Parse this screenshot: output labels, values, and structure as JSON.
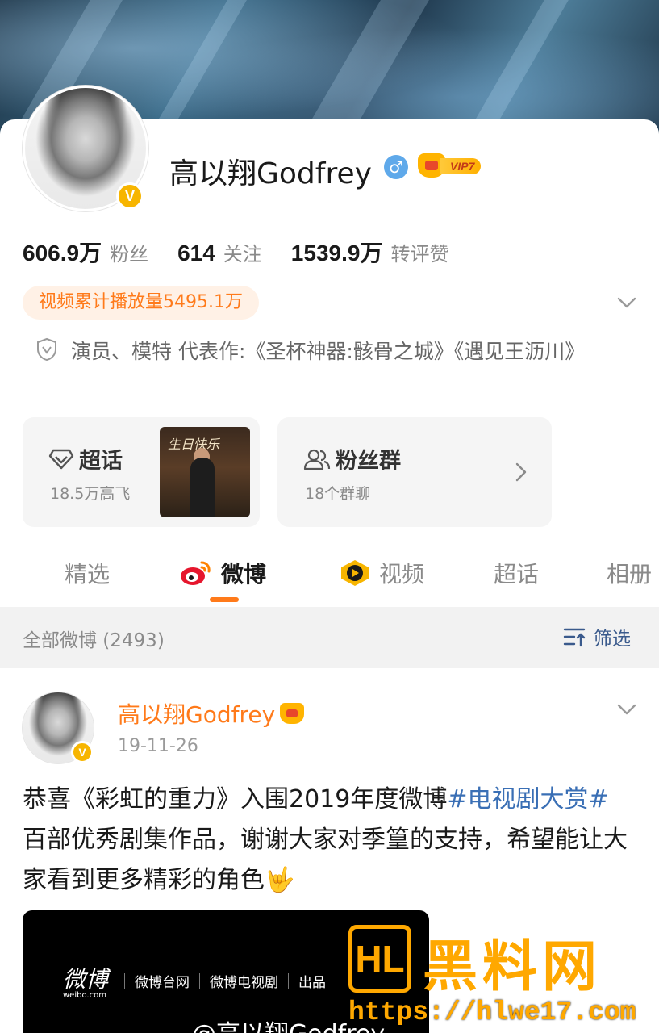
{
  "profile": {
    "name": "高以翔Godfrey",
    "vip_label": "VIP7",
    "verified_mark": "V",
    "gender_symbol": "♂"
  },
  "stats": [
    {
      "value": "606.9万",
      "label": "粉丝"
    },
    {
      "value": "614",
      "label": "关注"
    },
    {
      "value": "1539.9万",
      "label": "转评赞"
    }
  ],
  "play_count": "视频累计播放量5495.1万",
  "bio": "演员、模特 代表作:《圣杯神器:骸骨之城》《遇见王沥川》",
  "cards": {
    "chaohua": {
      "title": "超话",
      "sub": "18.5万高飞",
      "thumb_text": "生日快乐"
    },
    "fans": {
      "title": "粉丝群",
      "sub": "18个群聊"
    }
  },
  "tabs": [
    {
      "label": "精选",
      "active": false
    },
    {
      "label": "微博",
      "active": true
    },
    {
      "label": "视频",
      "active": false
    },
    {
      "label": "超话",
      "active": false
    },
    {
      "label": "相册",
      "active": false
    }
  ],
  "filter": {
    "count_label": "全部微博 (2493)",
    "button_label": "筛选"
  },
  "post": {
    "author": "高以翔Godfrey",
    "date": "19-11-26",
    "text_before": "恭喜《彩虹的重力》入围2019年度微博",
    "topic": "#电视剧大赏#",
    "text_after": " 百部优秀剧集作品，谢谢大家对季篁的支持，希望能让大家看到更多精彩的角色🤟"
  },
  "media": {
    "logo_main": "微博",
    "logo_sub": "weibo.com",
    "logo_2": "微博台网",
    "logo_3": "微博电视剧",
    "logo_4": "出品",
    "caption": "@高以翔Godfrey"
  },
  "watermark": {
    "logo_text": "HL",
    "title": "黑料网",
    "url": "https://hlwe17.com"
  },
  "colors": {
    "accent": "#ff7a1a",
    "topic_link": "#3a6fb5",
    "verified": "#f7b500",
    "watermark": "#ffa800"
  }
}
